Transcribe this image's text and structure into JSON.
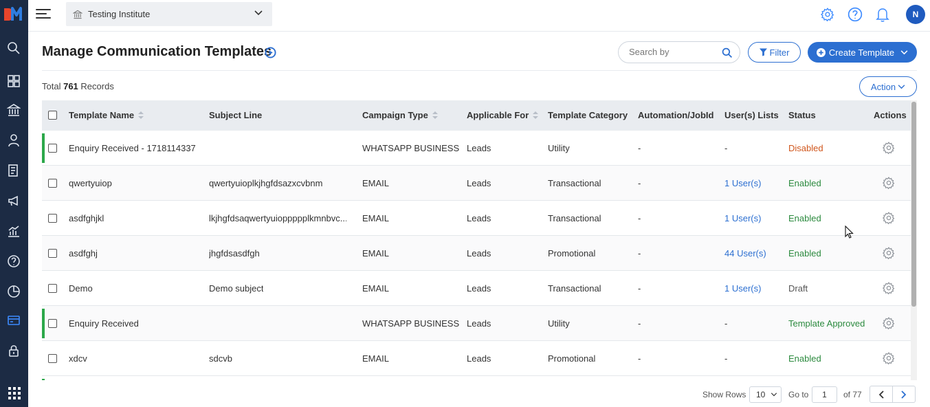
{
  "header": {
    "institute": "Testing Institute",
    "avatar_initial": "N"
  },
  "page": {
    "title": "Manage Communication Templates",
    "search_placeholder": "Search by",
    "filter_label": "Filter",
    "create_label": "Create Template",
    "total_prefix": "Total",
    "total_count": "761",
    "total_suffix": "Records",
    "action_label": "Action"
  },
  "table": {
    "columns": [
      "Template Name",
      "Subject Line",
      "Campaign Type",
      "Applicable For",
      "Template Category",
      "Automation/JobId",
      "User(s) Lists",
      "Status",
      "Actions"
    ],
    "rows": [
      {
        "name": "Enquiry Received - 1718114337",
        "subject": "",
        "campaign": "WHATSAPP BUSINESS",
        "applicable": "Leads",
        "category": "Utility",
        "automation": "-",
        "users": "-",
        "status": "Disabled",
        "status_kind": "dis",
        "marked": true
      },
      {
        "name": "qwertyuiop",
        "subject": "qwertyuioplkjhgfdsazxcvbnm",
        "campaign": "EMAIL",
        "applicable": "Leads",
        "category": "Transactional",
        "automation": "-",
        "users": "1 User(s)",
        "status": "Enabled",
        "status_kind": "en",
        "marked": false
      },
      {
        "name": "asdfghjkl",
        "subject": "lkjhgfdsaqwertyuioppppplkmnbvc...",
        "campaign": "EMAIL",
        "applicable": "Leads",
        "category": "Transactional",
        "automation": "-",
        "users": "1 User(s)",
        "status": "Enabled",
        "status_kind": "en",
        "marked": false
      },
      {
        "name": "asdfghj",
        "subject": "jhgfdsasdfgh",
        "campaign": "EMAIL",
        "applicable": "Leads",
        "category": "Promotional",
        "automation": "-",
        "users": "44 User(s)",
        "status": "Enabled",
        "status_kind": "en",
        "marked": false
      },
      {
        "name": "Demo",
        "subject": "Demo subject",
        "campaign": "EMAIL",
        "applicable": "Leads",
        "category": "Transactional",
        "automation": "-",
        "users": "1 User(s)",
        "status": "Draft",
        "status_kind": "draft",
        "marked": false
      },
      {
        "name": "Enquiry Received",
        "subject": "",
        "campaign": "WHATSAPP BUSINESS",
        "applicable": "Leads",
        "category": "Utility",
        "automation": "-",
        "users": "-",
        "status": "Template Approved",
        "status_kind": "en",
        "marked": true
      },
      {
        "name": "xdcv",
        "subject": "sdcvb",
        "campaign": "EMAIL",
        "applicable": "Leads",
        "category": "Promotional",
        "automation": "-",
        "users": "-",
        "status": "Enabled",
        "status_kind": "en",
        "marked": false
      }
    ]
  },
  "footer": {
    "show_rows_label": "Show Rows",
    "rows_value": "10",
    "goto_label": "Go to",
    "goto_value": "1",
    "of_pages": "of 77"
  },
  "colors": {
    "primary": "#2c6fd1",
    "sidebar": "#1c2b44",
    "enabled": "#2b8a3e",
    "disabled": "#d0561c",
    "marker": "#2ca84a"
  }
}
